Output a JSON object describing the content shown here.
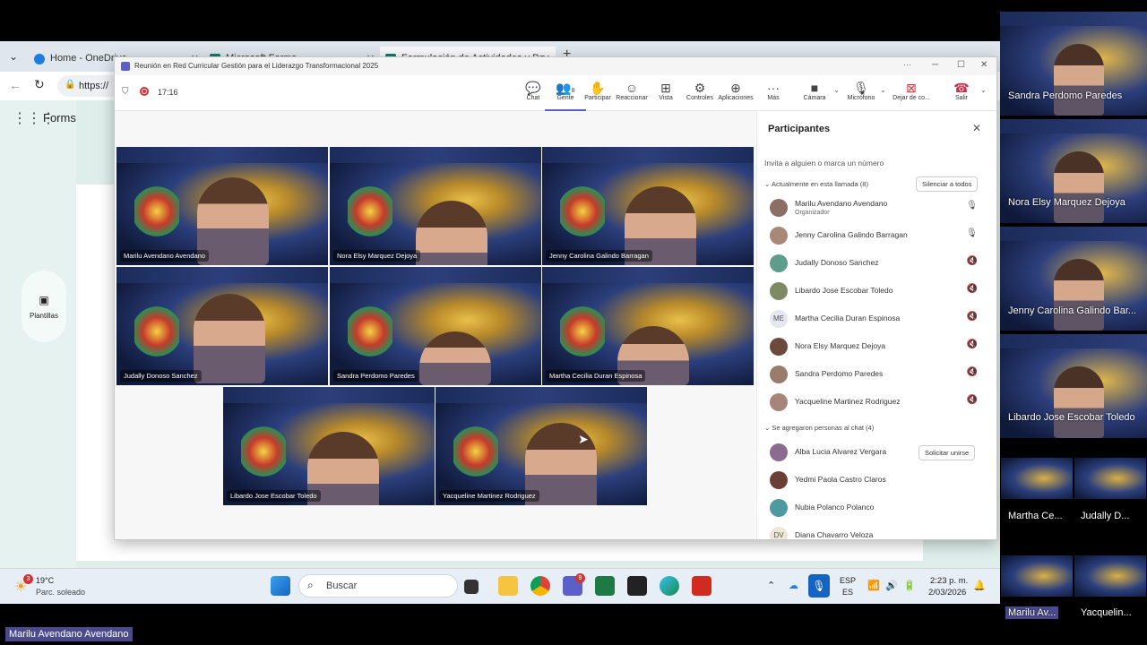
{
  "browser": {
    "tabs": [
      {
        "label": "Home - OneDrive"
      },
      {
        "label": "Microsoft Forms"
      },
      {
        "label": "Formulación de Actividades y Po..."
      }
    ],
    "address": "https://",
    "app_name": "Forms",
    "side_item": "Plantillas"
  },
  "teams": {
    "title": "Reunión en Red Curricular Gestión para el Liderazgo Transformacional 2025",
    "timer": "17:16",
    "toolbar": {
      "chat": "Chat",
      "people": "Gente",
      "people_count": "8",
      "raise": "Participar",
      "react": "Reaccionar",
      "view": "Vista",
      "controls": "Controles",
      "apps": "Aplicaciones",
      "more": "Más",
      "camera": "Cámara",
      "mic": "Micrófono",
      "share": "Dejar de co...",
      "leave": "Salir"
    },
    "tiles": [
      {
        "name": "Marilu Avendano Avendano"
      },
      {
        "name": "Nora Elsy Marquez Dejoya"
      },
      {
        "name": "Jenny Carolina Galindo Barragan"
      },
      {
        "name": "Judally Donoso Sanchez"
      },
      {
        "name": "Sandra Perdomo Paredes"
      },
      {
        "name": "Martha Cecilia Duran Espinosa"
      },
      {
        "name": "Libardo Jose Escobar Toledo"
      },
      {
        "name": "Yacqueline Martinez Rodriguez"
      }
    ],
    "participants": {
      "title": "Participantes",
      "invite": "Invita a alguien o marca un número",
      "in_call_header": "Actualmente en esta llamada (8)",
      "mute_all": "Silenciar a todos",
      "in_call": [
        {
          "name": "Marilu Avendano Avendano",
          "role": "Organizador",
          "initials": "",
          "mic": "on"
        },
        {
          "name": "Jenny Carolina Galindo Barragan",
          "role": "",
          "initials": "",
          "mic": "on"
        },
        {
          "name": "Judally Donoso Sanchez",
          "role": "",
          "initials": "",
          "mic": "off"
        },
        {
          "name": "Libardo Jose Escobar Toledo",
          "role": "",
          "initials": "",
          "mic": "off"
        },
        {
          "name": "Martha Cecilia Duran Espinosa",
          "role": "",
          "initials": "ME",
          "mic": "off"
        },
        {
          "name": "Nora Elsy Marquez Dejoya",
          "role": "",
          "initials": "",
          "mic": "off"
        },
        {
          "name": "Sandra Perdomo Paredes",
          "role": "",
          "initials": "",
          "mic": "off"
        },
        {
          "name": "Yacqueline Martinez Rodriguez",
          "role": "",
          "initials": "",
          "mic": "off"
        }
      ],
      "chat_header": "Se agregaron personas al chat (4)",
      "request_join": "Solicitar unirse",
      "chat": [
        {
          "name": "Alba Lucia Alvarez Vergara",
          "initials": ""
        },
        {
          "name": "Yedmi Paola Castro Claros",
          "initials": ""
        },
        {
          "name": "Nubia Polanco Polanco",
          "initials": ""
        },
        {
          "name": "Diana Chavarro Veloza",
          "initials": "DV"
        }
      ]
    }
  },
  "taskbar": {
    "weather_temp": "19°C",
    "weather_desc": "Parc. soleado",
    "weather_badge": "3",
    "search": "Buscar",
    "teams_badge": "9",
    "lang1": "ESP",
    "lang2": "ES",
    "time": "2:23 p. m.",
    "date": "2/03/2026"
  },
  "gallery": {
    "large": [
      {
        "name": "Sandra Perdomo Paredes"
      },
      {
        "name": "Nora Elsy Marquez Dejoya"
      },
      {
        "name": "Jenny Carolina Galindo Bar..."
      },
      {
        "name": "Libardo Jose Escobar Toledo"
      }
    ],
    "small": [
      {
        "name": "Martha Ce..."
      },
      {
        "name": "Judally  D..."
      },
      {
        "name": "Marilu Av..."
      },
      {
        "name": "Yacquelin..."
      }
    ]
  },
  "presenter_label": "Marilu Avendano Avendano",
  "colors": {
    "accent": "#5b5fc7",
    "leave": "#c4314b",
    "record": "#d13438"
  }
}
